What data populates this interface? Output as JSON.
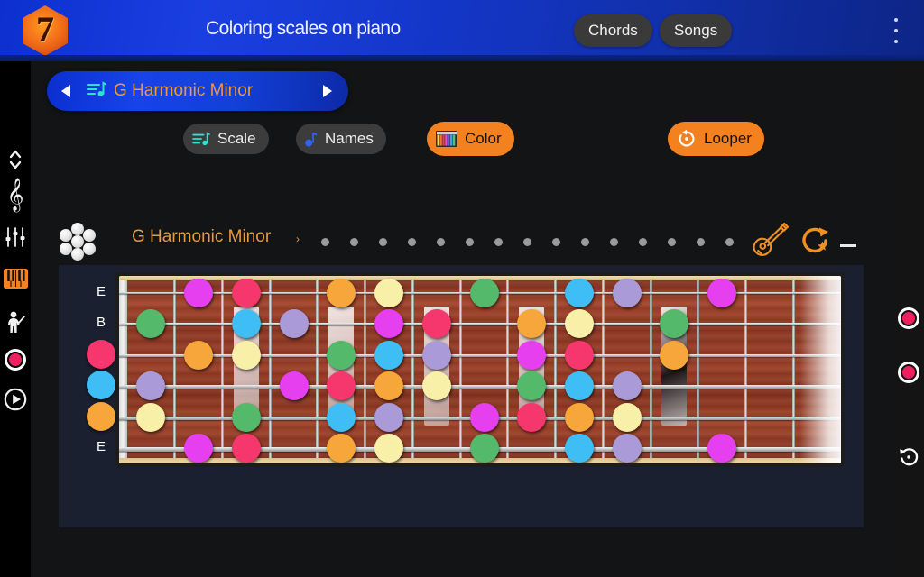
{
  "header": {
    "logo_text": "7",
    "title": "Coloring scales on piano",
    "chords_label": "Chords",
    "songs_label": "Songs",
    "menu_icon": "kebab-menu-icon",
    "bg_color": "#1436c7"
  },
  "scale_selector": {
    "value": "G Harmonic Minor",
    "prev_icon": "chevron-left-icon",
    "next_icon": "chevron-right-icon",
    "list_icon": "music-list-icon",
    "text_color": "#e89a3c"
  },
  "toolbar": {
    "scale_label": "Scale",
    "names_label": "Names",
    "color_label": "Color",
    "looper_label": "Looper",
    "active_color": "#f4811f"
  },
  "scale_row": {
    "title": "G Harmonic Minor",
    "caret": "›",
    "flower_icon": "note-cluster-icon",
    "guitar_icon": "guitar-icon",
    "repeat_icon": "repeat-star-icon",
    "dash_icon": "minus-icon",
    "dot_count": 15,
    "dot_color": "#9a9a9a"
  },
  "left_rail": {
    "items": [
      {
        "name": "updown-chevrons-icon"
      },
      {
        "name": "treble-clef-icon"
      },
      {
        "name": "equalizer-sliders-icon"
      },
      {
        "name": "piano-keys-icon",
        "active": true,
        "color": "#f4811f"
      },
      {
        "name": "conductor-icon"
      },
      {
        "name": "record-icon",
        "color": "#ef2060"
      },
      {
        "name": "play-icon"
      }
    ]
  },
  "right_rail": {
    "items": [
      {
        "name": "record-icon",
        "color": "#ef2060"
      },
      {
        "name": "record-icon",
        "color": "#ef2060"
      },
      {
        "name": "undo-icon"
      }
    ]
  },
  "fretboard": {
    "string_labels": [
      "E",
      "B",
      "",
      "",
      "",
      "E"
    ],
    "open_string_dots": [
      {
        "string": 2,
        "color": "#f6376e"
      },
      {
        "string": 3,
        "color": "#3fbdf5"
      },
      {
        "string": 4,
        "color": "#f6a63a"
      }
    ],
    "fret_count": 15,
    "inlays": [
      3,
      5,
      7,
      9,
      12
    ],
    "note_colors": {
      "magenta": "#e63ff0",
      "pink": "#f6376e",
      "orange": "#f6a63a",
      "cream": "#f8f0a8",
      "green": "#54b96a",
      "blue": "#3fbdf5",
      "lavender": "#ab9ad8"
    },
    "notes": [
      {
        "s": 0,
        "f": 2,
        "c": "magenta"
      },
      {
        "s": 0,
        "f": 3,
        "c": "pink"
      },
      {
        "s": 0,
        "f": 5,
        "c": "orange"
      },
      {
        "s": 0,
        "f": 6,
        "c": "cream"
      },
      {
        "s": 0,
        "f": 8,
        "c": "green"
      },
      {
        "s": 0,
        "f": 10,
        "c": "blue"
      },
      {
        "s": 0,
        "f": 11,
        "c": "lavender"
      },
      {
        "s": 0,
        "f": 13,
        "c": "magenta"
      },
      {
        "s": 1,
        "f": 1,
        "c": "green"
      },
      {
        "s": 1,
        "f": 3,
        "c": "blue"
      },
      {
        "s": 1,
        "f": 4,
        "c": "lavender"
      },
      {
        "s": 1,
        "f": 6,
        "c": "magenta"
      },
      {
        "s": 1,
        "f": 7,
        "c": "pink"
      },
      {
        "s": 1,
        "f": 9,
        "c": "orange"
      },
      {
        "s": 1,
        "f": 10,
        "c": "cream"
      },
      {
        "s": 1,
        "f": 12,
        "c": "green"
      },
      {
        "s": 2,
        "f": 2,
        "c": "orange"
      },
      {
        "s": 2,
        "f": 3,
        "c": "cream"
      },
      {
        "s": 2,
        "f": 5,
        "c": "green"
      },
      {
        "s": 2,
        "f": 6,
        "c": "blue"
      },
      {
        "s": 2,
        "f": 7,
        "c": "lavender"
      },
      {
        "s": 2,
        "f": 9,
        "c": "magenta"
      },
      {
        "s": 2,
        "f": 10,
        "c": "pink"
      },
      {
        "s": 2,
        "f": 12,
        "c": "orange"
      },
      {
        "s": 3,
        "f": 1,
        "c": "lavender"
      },
      {
        "s": 3,
        "f": 4,
        "c": "magenta"
      },
      {
        "s": 3,
        "f": 5,
        "c": "pink"
      },
      {
        "s": 3,
        "f": 6,
        "c": "orange"
      },
      {
        "s": 3,
        "f": 7,
        "c": "cream"
      },
      {
        "s": 3,
        "f": 9,
        "c": "green"
      },
      {
        "s": 3,
        "f": 10,
        "c": "blue"
      },
      {
        "s": 3,
        "f": 11,
        "c": "lavender"
      },
      {
        "s": 4,
        "f": 1,
        "c": "cream"
      },
      {
        "s": 4,
        "f": 3,
        "c": "green"
      },
      {
        "s": 4,
        "f": 5,
        "c": "blue"
      },
      {
        "s": 4,
        "f": 6,
        "c": "lavender"
      },
      {
        "s": 4,
        "f": 8,
        "c": "magenta"
      },
      {
        "s": 4,
        "f": 9,
        "c": "pink"
      },
      {
        "s": 4,
        "f": 10,
        "c": "orange"
      },
      {
        "s": 4,
        "f": 11,
        "c": "cream"
      },
      {
        "s": 5,
        "f": 2,
        "c": "magenta"
      },
      {
        "s": 5,
        "f": 3,
        "c": "pink"
      },
      {
        "s": 5,
        "f": 5,
        "c": "orange"
      },
      {
        "s": 5,
        "f": 6,
        "c": "cream"
      },
      {
        "s": 5,
        "f": 8,
        "c": "green"
      },
      {
        "s": 5,
        "f": 10,
        "c": "blue"
      },
      {
        "s": 5,
        "f": 11,
        "c": "lavender"
      },
      {
        "s": 5,
        "f": 13,
        "c": "magenta"
      }
    ]
  }
}
